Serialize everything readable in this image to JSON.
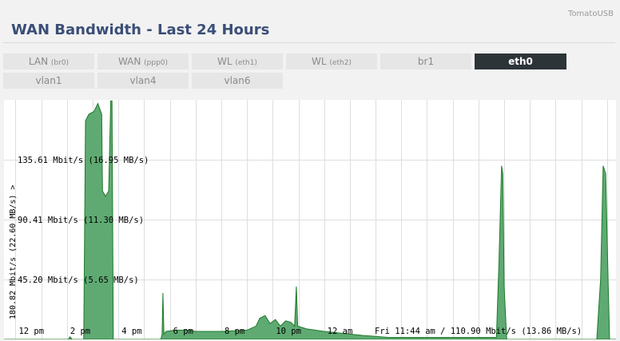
{
  "app": {
    "brand": "TomatoUSB"
  },
  "page": {
    "title": "WAN Bandwidth - Last 24 Hours"
  },
  "tabs": [
    {
      "label": "LAN ",
      "sub": "(br0)",
      "active": false
    },
    {
      "label": "WAN ",
      "sub": "(ppp0)",
      "active": false
    },
    {
      "label": "WL ",
      "sub": "(eth1)",
      "active": false
    },
    {
      "label": "WL ",
      "sub": "(eth2)",
      "active": false
    },
    {
      "label": "br1",
      "sub": "",
      "active": false
    },
    {
      "label": "eth0",
      "sub": "",
      "active": true
    },
    {
      "label": "vlan1",
      "sub": "",
      "active": false
    },
    {
      "label": "vlan4",
      "sub": "",
      "active": false
    },
    {
      "label": "vlan6",
      "sub": "",
      "active": false
    }
  ],
  "chart_data": {
    "type": "area",
    "ylabel": "180.82 Mbit/s (22.60 MB/s) >",
    "ylim": [
      0,
      180.82
    ],
    "y_ticks": [
      {
        "value": 135.61,
        "label": "135.61 Mbit/s (16.95 MB/s)"
      },
      {
        "value": 90.41,
        "label": "90.41 Mbit/s (11.30 MB/s)"
      },
      {
        "value": 45.2,
        "label": "45.20 Mbit/s (5.65 MB/s)"
      }
    ],
    "x_ticks": [
      {
        "hour": 0,
        "label": "12 pm"
      },
      {
        "hour": 2,
        "label": "2 pm"
      },
      {
        "hour": 4,
        "label": "4 pm"
      },
      {
        "hour": 6,
        "label": "6 pm"
      },
      {
        "hour": 8,
        "label": "8 pm"
      },
      {
        "hour": 10,
        "label": "10 pm"
      },
      {
        "hour": 12,
        "label": "12 am"
      }
    ],
    "xlim": [
      -0.45,
      23.35
    ],
    "grid": true,
    "status": "Fri 11:44 am / 110.90 Mbit/s (13.86 MB/s)",
    "colors": {
      "fill": "#5faa72",
      "stroke": "#1d7a2a",
      "grid": "#dedede"
    },
    "series": [
      {
        "values": [
          [
            -0.45,
            0
          ],
          [
            2.05,
            0
          ],
          [
            2.12,
            2
          ],
          [
            2.2,
            0
          ],
          [
            2.65,
            0
          ],
          [
            2.72,
            165
          ],
          [
            2.85,
            170
          ],
          [
            3.05,
            172
          ],
          [
            3.2,
            178
          ],
          [
            3.35,
            170
          ],
          [
            3.38,
            112
          ],
          [
            3.5,
            108
          ],
          [
            3.62,
            112
          ],
          [
            3.7,
            180
          ],
          [
            3.75,
            180
          ],
          [
            3.8,
            0
          ],
          [
            5.65,
            0
          ],
          [
            5.7,
            4
          ],
          [
            5.73,
            35
          ],
          [
            5.77,
            4
          ],
          [
            5.85,
            6
          ],
          [
            6.2,
            7
          ],
          [
            6.8,
            7
          ],
          [
            7.0,
            6
          ],
          [
            8.0,
            6
          ],
          [
            9.0,
            7
          ],
          [
            9.35,
            10
          ],
          [
            9.5,
            16
          ],
          [
            9.7,
            18
          ],
          [
            9.9,
            12
          ],
          [
            10.1,
            15
          ],
          [
            10.3,
            10
          ],
          [
            10.5,
            14
          ],
          [
            10.7,
            13
          ],
          [
            10.85,
            10
          ],
          [
            10.92,
            40
          ],
          [
            10.97,
            10
          ],
          [
            11.3,
            8
          ],
          [
            12.0,
            6
          ],
          [
            13.5,
            3
          ],
          [
            14.5,
            1.5
          ],
          [
            18.7,
            1.5
          ],
          [
            18.8,
            60
          ],
          [
            18.9,
            131
          ],
          [
            18.95,
            125
          ],
          [
            19.0,
            40
          ],
          [
            19.1,
            0
          ],
          [
            22.6,
            0
          ],
          [
            22.75,
            45
          ],
          [
            22.85,
            131
          ],
          [
            22.95,
            125
          ],
          [
            23.05,
            40
          ],
          [
            23.1,
            0
          ],
          [
            23.35,
            0
          ]
        ]
      }
    ]
  }
}
